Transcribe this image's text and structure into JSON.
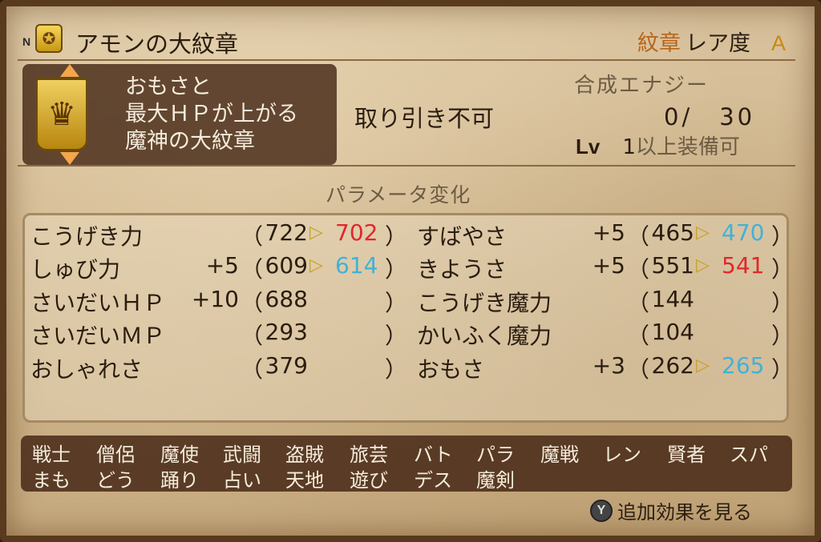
{
  "header": {
    "rank_letter": "N",
    "item_name": "アモンの大紋章",
    "category": "紋章",
    "rarity_label": "レア度",
    "rarity_grade": "A"
  },
  "info": {
    "lines": [
      "おもさと",
      "最大ＨＰが上がる",
      "魔神の大紋章"
    ]
  },
  "trade": "取り引き不可",
  "synthesis": {
    "label": "合成エナジー",
    "value": "0/　30"
  },
  "level": {
    "label": "Lv",
    "value": "1",
    "suffix": "以上装備可"
  },
  "param_title": "パラメータ変化",
  "stats_left": [
    {
      "name": "こうげき力",
      "bonus": "",
      "old": "722",
      "new": "702",
      "change": "down"
    },
    {
      "name": "しゅび力",
      "bonus": "+5",
      "old": "609",
      "new": "614",
      "change": "up"
    },
    {
      "name": "さいだいＨＰ",
      "bonus": "+10",
      "old": "688",
      "new": "",
      "change": "none"
    },
    {
      "name": "さいだいＭＰ",
      "bonus": "",
      "old": "293",
      "new": "",
      "change": "none"
    },
    {
      "name": "おしゃれさ",
      "bonus": "",
      "old": "379",
      "new": "",
      "change": "none"
    }
  ],
  "stats_right": [
    {
      "name": "すばやさ",
      "bonus": "+5",
      "old": "465",
      "new": "470",
      "change": "up"
    },
    {
      "name": "きようさ",
      "bonus": "+5",
      "old": "551",
      "new": "541",
      "change": "down"
    },
    {
      "name": "こうげき魔力",
      "bonus": "",
      "old": "144",
      "new": "",
      "change": "none"
    },
    {
      "name": "かいふく魔力",
      "bonus": "",
      "old": "104",
      "new": "",
      "change": "none"
    },
    {
      "name": "おもさ",
      "bonus": "+3",
      "old": "262",
      "new": "265",
      "change": "up"
    }
  ],
  "jobs_row1": [
    "戦士",
    "僧侶",
    "魔使",
    "武闘",
    "盗賊",
    "旅芸",
    "バト",
    "パラ",
    "魔戦",
    "レン",
    "賢者",
    "スパ"
  ],
  "jobs_row2": [
    "まも",
    "どう",
    "踊り",
    "占い",
    "天地",
    "遊び",
    "デス",
    "魔剣"
  ],
  "footer": {
    "button": "Y",
    "label": "追加効果を見る"
  },
  "colors": {
    "down": "#e0282c",
    "up": "#40b2d8",
    "arrow": "#c8a020"
  }
}
